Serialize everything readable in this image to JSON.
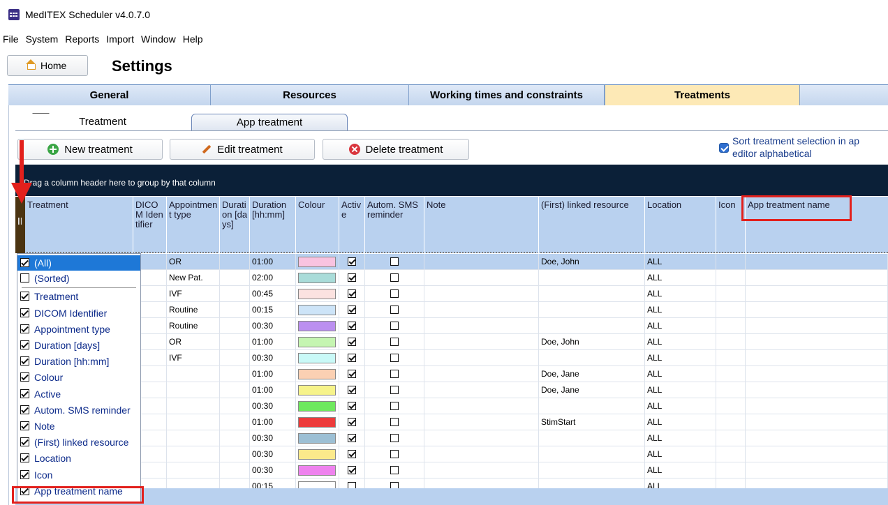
{
  "window": {
    "title": "MedITEX Scheduler v4.0.7.0"
  },
  "menu": [
    "File",
    "System",
    "Reports",
    "Import",
    "Window",
    "Help"
  ],
  "home_button": "Home",
  "page_title": "Settings",
  "main_tabs": [
    {
      "label": "General",
      "active": false
    },
    {
      "label": "Resources",
      "active": false
    },
    {
      "label": "Working times and constraints",
      "active": false
    },
    {
      "label": "Treatments",
      "active": true
    }
  ],
  "sub_tabs": [
    {
      "label": "Treatment",
      "active": true
    },
    {
      "label": "App treatment",
      "active": false
    }
  ],
  "toolbar": {
    "new": "New treatment",
    "edit": "Edit treatment",
    "delete": "Delete treatment",
    "sort_label_1": "Sort treatment selection in ap",
    "sort_label_2": "editor alphabetical",
    "sort_checked": true
  },
  "group_hint": "Drag a column header here to group by that column",
  "columns": {
    "treatment": "Treatment",
    "dicom": "DICOM Identifier",
    "appt_type": "Appointment type",
    "dur_days": "Duration [days]",
    "dur_hhmm": "Duration [hh:mm]",
    "colour": "Colour",
    "active": "Active",
    "sms": "Autom. SMS reminder",
    "note": "Note",
    "linked": "(First) linked resource",
    "location": "Location",
    "icon": "Icon",
    "app_name": "App treatment name"
  },
  "rows": [
    {
      "type": "OR",
      "dur": "01:00",
      "colour": "#f9c3e0",
      "active": true,
      "sms": false,
      "linked": "Doe, John",
      "location": "ALL",
      "selected": true
    },
    {
      "type": "New Pat.",
      "dur": "02:00",
      "colour": "#a9dcd9",
      "active": true,
      "sms": false,
      "linked": "",
      "location": "ALL"
    },
    {
      "type": "IVF",
      "dur": "00:45",
      "colour": "#fbe2e0",
      "active": true,
      "sms": false,
      "linked": "",
      "location": "ALL"
    },
    {
      "type": "Routine",
      "dur": "00:15",
      "colour": "#cde4f8",
      "active": true,
      "sms": false,
      "linked": "",
      "location": "ALL"
    },
    {
      "type": "Routine",
      "dur": "00:30",
      "colour": "#bb8ff0",
      "active": true,
      "sms": false,
      "linked": "",
      "location": "ALL"
    },
    {
      "type": "OR",
      "dur": "01:00",
      "colour": "#c5f5b1",
      "active": true,
      "sms": false,
      "linked": "Doe, John",
      "location": "ALL"
    },
    {
      "type": "IVF",
      "dur": "00:30",
      "colour": "#c9f9f7",
      "active": true,
      "sms": false,
      "linked": "",
      "location": "ALL"
    },
    {
      "type": "",
      "dur": "01:00",
      "colour": "#fbd0b3",
      "active": true,
      "sms": false,
      "linked": "Doe, Jane",
      "location": "ALL"
    },
    {
      "type": "",
      "dur": "01:00",
      "colour": "#f6f38a",
      "active": true,
      "sms": false,
      "linked": "Doe, Jane",
      "location": "ALL"
    },
    {
      "type": "",
      "dur": "00:30",
      "colour": "#6ee95e",
      "active": true,
      "sms": false,
      "linked": "",
      "location": "ALL"
    },
    {
      "type": "",
      "dur": "01:00",
      "colour": "#ed3b3b",
      "active": true,
      "sms": false,
      "linked": "StimStart",
      "location": "ALL"
    },
    {
      "type": "",
      "dur": "00:30",
      "colour": "#9cbfd4",
      "active": true,
      "sms": false,
      "linked": "",
      "location": "ALL"
    },
    {
      "type": "",
      "dur": "00:30",
      "colour": "#fbe98b",
      "active": true,
      "sms": false,
      "linked": "",
      "location": "ALL"
    },
    {
      "type": "",
      "dur": "00:30",
      "colour": "#ee82ee",
      "active": true,
      "sms": false,
      "linked": "",
      "location": "ALL"
    },
    {
      "type": "",
      "dur": "00:15",
      "colour": "#ffffff",
      "active": false,
      "sms": false,
      "linked": "",
      "location": "ALL"
    }
  ],
  "column_chooser": [
    {
      "label": "(All)",
      "checked": true,
      "selected": true
    },
    {
      "label": "(Sorted)",
      "checked": false
    },
    {
      "label": "Treatment",
      "checked": true
    },
    {
      "label": "DICOM Identifier",
      "checked": true
    },
    {
      "label": "Appointment type",
      "checked": true
    },
    {
      "label": "Duration [days]",
      "checked": true
    },
    {
      "label": "Duration [hh:mm]",
      "checked": true
    },
    {
      "label": "Colour",
      "checked": true
    },
    {
      "label": "Active",
      "checked": true
    },
    {
      "label": "Autom. SMS reminder",
      "checked": true
    },
    {
      "label": "Note",
      "checked": true
    },
    {
      "label": "(First) linked resource",
      "checked": true
    },
    {
      "label": "Location",
      "checked": true
    },
    {
      "label": "Icon",
      "checked": true
    },
    {
      "label": "App treatment name",
      "checked": true
    }
  ],
  "colors": {
    "annotation": "#e2201c",
    "tab_active": "#fde9b6",
    "header": "#b9d1ef",
    "group_bar": "#0b2038"
  }
}
